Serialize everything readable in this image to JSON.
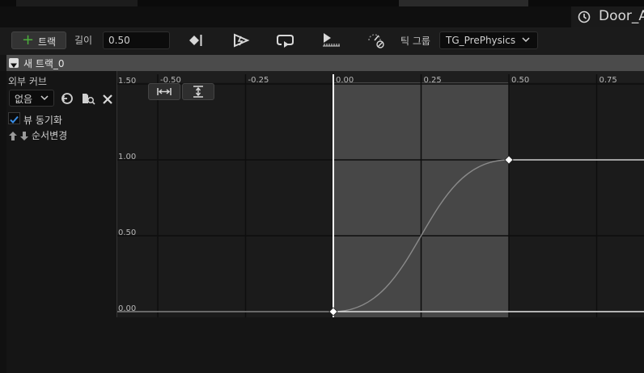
{
  "window": {
    "asset_title": "Door_A"
  },
  "toolbar": {
    "add_track_label": "트랙",
    "length_label": "길이",
    "length_value": "0.50",
    "tick_group_label": "틱 그룹",
    "tick_group_value": "TG_PrePhysics"
  },
  "track": {
    "name": "새 트랙_0"
  },
  "sidebar": {
    "external_curve_label": "외부 커브",
    "curve_select_value": "없음",
    "sync_view_label": "뷰 동기화",
    "sync_view_checked": true,
    "reorder_label": "순서변경"
  },
  "graph": {
    "x_ticks": [
      "-0.50",
      "-0.25",
      "0.00",
      "0.25",
      "0.50",
      "0.75"
    ],
    "y_ticks": [
      "1.50",
      "1.00",
      "0.50",
      "0.00"
    ],
    "colors": {
      "grid_bg": "#1b1b1b",
      "active_region": "#474747",
      "curve": "#8a8a8a",
      "playhead": "#ffffff",
      "accent_check": "#3a8ee6"
    }
  },
  "chart_data": {
    "type": "line",
    "series": [
      {
        "values": [
          [
            0.0,
            0.0
          ],
          [
            0.5,
            1.0
          ]
        ]
      }
    ],
    "interpolation": "cubic",
    "xlim": [
      -0.62,
      0.88
    ],
    "ylim": [
      0.0,
      1.5
    ],
    "active_range": [
      0.0,
      0.5
    ]
  }
}
